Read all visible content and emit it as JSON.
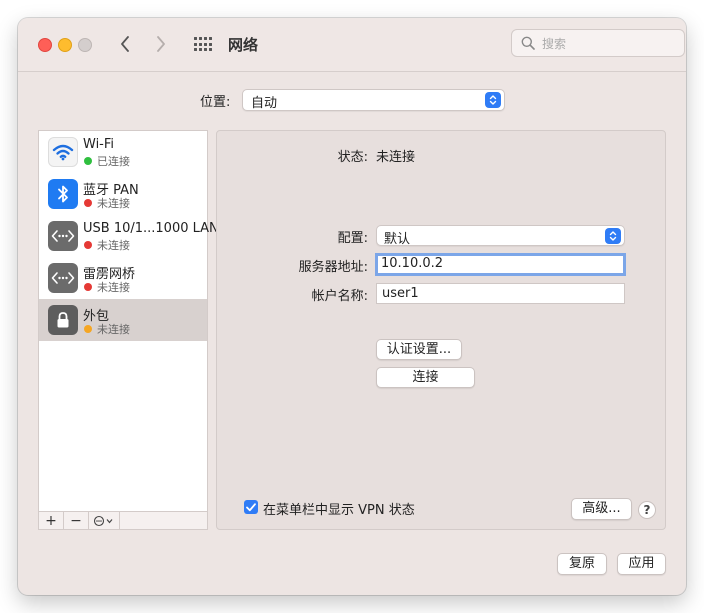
{
  "window": {
    "title": "网络",
    "search_placeholder": "搜索"
  },
  "location": {
    "label": "位置:",
    "value": "自动"
  },
  "services": [
    {
      "name": "Wi-Fi",
      "status": "已连接",
      "status_color": "#2fbf3f",
      "icon": "wifi-icon",
      "selected": false
    },
    {
      "name": "蓝牙 PAN",
      "status": "未连接",
      "status_color": "#e53935",
      "icon": "bluetooth-icon",
      "selected": false
    },
    {
      "name": "USB 10/1...1000 LAN",
      "status": "未连接",
      "status_color": "#e53935",
      "icon": "ethernet-icon",
      "selected": false
    },
    {
      "name": "雷雳网桥",
      "status": "未连接",
      "status_color": "#e53935",
      "icon": "ethernet-icon",
      "selected": false
    },
    {
      "name": "外包",
      "status": "未连接",
      "status_color": "#f5a623",
      "icon": "lock-icon",
      "selected": true
    }
  ],
  "sidebar_footer": {
    "add": "+",
    "remove": "−"
  },
  "detail": {
    "status_label": "状态:",
    "status_value": "未连接",
    "config_label": "配置:",
    "config_value": "默认",
    "server_label": "服务器地址:",
    "server_value": "10.10.0.2",
    "account_label": "帐户名称:",
    "account_value": "user1",
    "auth_button": "认证设置...",
    "connect_button": "连接",
    "show_vpn_label": "在菜单栏中显示 VPN 状态",
    "show_vpn_checked": true,
    "advanced_button": "高级...",
    "help": "?"
  },
  "bottom": {
    "revert_button": "复原",
    "apply_button": "应用"
  },
  "colors": {
    "accent": "#2f7cf6",
    "window_bg": "#ede5e3"
  }
}
